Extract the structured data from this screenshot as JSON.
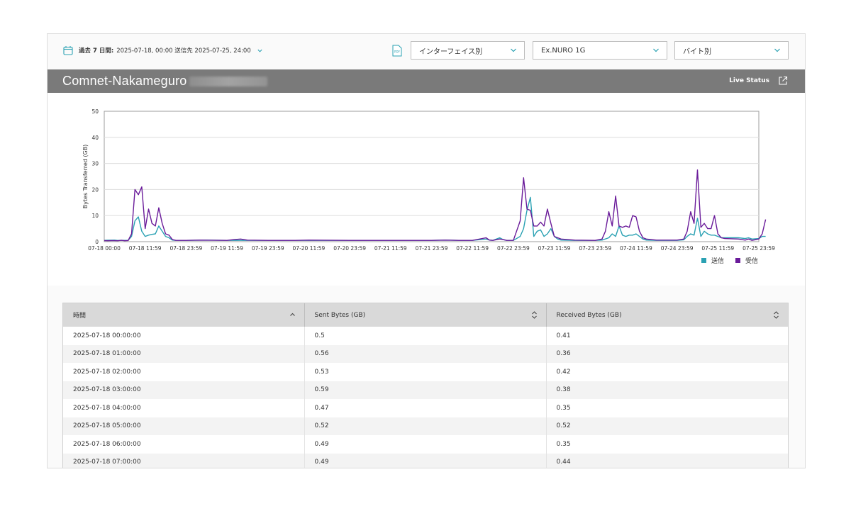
{
  "toolbar": {
    "date_range_bold": "過去 7 日間:",
    "date_range_text": "2025-07-18, 00:00 送信先 2025-07-25, 24:00",
    "pdf_label": "PDF",
    "filter_interface": "インターフェイス別",
    "filter_uplink": "Ex.NURO 1G",
    "filter_unit": "バイト別"
  },
  "header": {
    "device_name": "Comnet-Nakameguro",
    "live_status": "Live Status"
  },
  "colors": {
    "sent": "#2aa1b3",
    "received": "#6a1b9a",
    "title_bar": "#7a7a7a"
  },
  "chart_data": {
    "type": "line",
    "ylabel": "Bytes Transferred (GB)",
    "xlabel": "",
    "ylim": [
      0,
      50
    ],
    "yticks": [
      "0",
      "10",
      "20",
      "30",
      "40",
      "50"
    ],
    "xticks": [
      "07-18 00:00",
      "07-18 11:59",
      "07-18 23:59",
      "07-19 11:59",
      "07-19 23:59",
      "07-20 11:59",
      "07-20 23:59",
      "07-21 11:59",
      "07-21 23:59",
      "07-22 11:59",
      "07-22 23:59",
      "07-23 11:59",
      "07-23 23:59",
      "07-24 11:59",
      "07-24 23:59",
      "07-25 11:59",
      "07-25 23:59"
    ],
    "x_unit": "hours since 07-18 00:00",
    "grid": true,
    "legend_position": "bottom-right",
    "series": [
      {
        "name": "送信",
        "color": "#2aa1b3",
        "points": [
          [
            0,
            0.5
          ],
          [
            1,
            0.56
          ],
          [
            2,
            0.53
          ],
          [
            3,
            0.59
          ],
          [
            4,
            0.47
          ],
          [
            5,
            0.52
          ],
          [
            6,
            0.49
          ],
          [
            7,
            0.49
          ],
          [
            8,
            2
          ],
          [
            9,
            8
          ],
          [
            10,
            9.5
          ],
          [
            11,
            4
          ],
          [
            12,
            2
          ],
          [
            13,
            2.5
          ],
          [
            14,
            2.8
          ],
          [
            15,
            3
          ],
          [
            16,
            6
          ],
          [
            17,
            4
          ],
          [
            18,
            2
          ],
          [
            19,
            1.5
          ],
          [
            20,
            0.6
          ],
          [
            21,
            0.5
          ],
          [
            24,
            0.5
          ],
          [
            30,
            0.6
          ],
          [
            36,
            0.5
          ],
          [
            40,
            0.5
          ],
          [
            48,
            0.5
          ],
          [
            56,
            0.5
          ],
          [
            60,
            0.5
          ],
          [
            72,
            0.5
          ],
          [
            84,
            0.5
          ],
          [
            96,
            0.5
          ],
          [
            100,
            0.6
          ],
          [
            104,
            0.5
          ],
          [
            108,
            0.5
          ],
          [
            112,
            1
          ],
          [
            113,
            0.6
          ],
          [
            114,
            0.5
          ],
          [
            116,
            1.5
          ],
          [
            117,
            0.8
          ],
          [
            118,
            0.5
          ],
          [
            120,
            0.5
          ],
          [
            122,
            2
          ],
          [
            123,
            5
          ],
          [
            124,
            12
          ],
          [
            125,
            17
          ],
          [
            126,
            2
          ],
          [
            127,
            4
          ],
          [
            128,
            4.5
          ],
          [
            129,
            2
          ],
          [
            130,
            3
          ],
          [
            131,
            5
          ],
          [
            132,
            2
          ],
          [
            133,
            1
          ],
          [
            134,
            0.6
          ],
          [
            138,
            0.5
          ],
          [
            144,
            0.5
          ],
          [
            146,
            0.6
          ],
          [
            148,
            1.5
          ],
          [
            149,
            3
          ],
          [
            150,
            2
          ],
          [
            151,
            6
          ],
          [
            152,
            2.5
          ],
          [
            153,
            2
          ],
          [
            154,
            2.5
          ],
          [
            155,
            2.5
          ],
          [
            156,
            3
          ],
          [
            157,
            2
          ],
          [
            158,
            1
          ],
          [
            159,
            0.6
          ],
          [
            162,
            0.5
          ],
          [
            168,
            0.5
          ],
          [
            170,
            0.7
          ],
          [
            171,
            2
          ],
          [
            172,
            3
          ],
          [
            173,
            2.5
          ],
          [
            174,
            9
          ],
          [
            175,
            2
          ],
          [
            176,
            4
          ],
          [
            177,
            3
          ],
          [
            178,
            2.5
          ],
          [
            179,
            2.5
          ],
          [
            180,
            2
          ],
          [
            181,
            1.5
          ],
          [
            182,
            1.5
          ],
          [
            186,
            1.5
          ],
          [
            188,
            1.2
          ],
          [
            189,
            1.5
          ],
          [
            190,
            1
          ],
          [
            192,
            1.2
          ],
          [
            193,
            2
          ],
          [
            194,
            2
          ]
        ]
      },
      {
        "name": "受信",
        "color": "#6a1b9a",
        "points": [
          [
            0,
            0.41
          ],
          [
            1,
            0.36
          ],
          [
            2,
            0.42
          ],
          [
            3,
            0.38
          ],
          [
            4,
            0.35
          ],
          [
            5,
            0.52
          ],
          [
            6,
            0.35
          ],
          [
            7,
            0.44
          ],
          [
            8,
            3
          ],
          [
            9,
            20
          ],
          [
            10,
            18
          ],
          [
            11,
            21
          ],
          [
            12,
            5
          ],
          [
            13,
            12.5
          ],
          [
            14,
            7
          ],
          [
            15,
            6
          ],
          [
            16,
            13
          ],
          [
            17,
            7
          ],
          [
            18,
            3
          ],
          [
            19,
            2.5
          ],
          [
            20,
            0.8
          ],
          [
            21,
            0.5
          ],
          [
            24,
            0.5
          ],
          [
            28,
            0.6
          ],
          [
            36,
            0.5
          ],
          [
            38,
            0.8
          ],
          [
            40,
            1
          ],
          [
            42,
            0.6
          ],
          [
            48,
            0.5
          ],
          [
            56,
            0.5
          ],
          [
            60,
            0.6
          ],
          [
            72,
            0.5
          ],
          [
            84,
            0.5
          ],
          [
            96,
            0.5
          ],
          [
            100,
            0.6
          ],
          [
            104,
            0.5
          ],
          [
            108,
            0.5
          ],
          [
            112,
            1.5
          ],
          [
            113,
            0.6
          ],
          [
            114,
            0.5
          ],
          [
            116,
            1
          ],
          [
            117,
            0.8
          ],
          [
            118,
            0.5
          ],
          [
            120,
            0.5
          ],
          [
            122,
            8
          ],
          [
            123,
            24.5
          ],
          [
            124,
            12.5
          ],
          [
            125,
            12
          ],
          [
            126,
            6
          ],
          [
            127,
            6
          ],
          [
            128,
            7.5
          ],
          [
            129,
            6
          ],
          [
            130,
            12.5
          ],
          [
            131,
            7
          ],
          [
            132,
            2
          ],
          [
            133,
            1.5
          ],
          [
            134,
            1
          ],
          [
            138,
            0.6
          ],
          [
            144,
            0.5
          ],
          [
            146,
            1
          ],
          [
            147,
            4
          ],
          [
            148,
            11.5
          ],
          [
            149,
            6
          ],
          [
            150,
            17.5
          ],
          [
            151,
            6
          ],
          [
            152,
            5.5
          ],
          [
            153,
            6
          ],
          [
            154,
            5.5
          ],
          [
            155,
            10
          ],
          [
            156,
            9.5
          ],
          [
            157,
            4
          ],
          [
            158,
            1.5
          ],
          [
            159,
            1
          ],
          [
            162,
            0.6
          ],
          [
            168,
            0.6
          ],
          [
            170,
            1
          ],
          [
            171,
            4
          ],
          [
            172,
            11.5
          ],
          [
            173,
            7
          ],
          [
            174,
            27.5
          ],
          [
            175,
            5.5
          ],
          [
            176,
            7
          ],
          [
            177,
            5
          ],
          [
            178,
            5
          ],
          [
            179,
            10
          ],
          [
            180,
            3
          ],
          [
            181,
            1.5
          ],
          [
            182,
            1.2
          ],
          [
            186,
            1
          ],
          [
            188,
            0.6
          ],
          [
            189,
            1
          ],
          [
            190,
            0.5
          ],
          [
            192,
            1
          ],
          [
            193,
            3
          ],
          [
            194,
            8.5
          ]
        ]
      }
    ]
  },
  "table": {
    "headers": [
      "時間",
      "Sent Bytes (GB)",
      "Received Bytes (GB)"
    ],
    "rows": [
      [
        "2025-07-18 00:00:00",
        "0.5",
        "0.41"
      ],
      [
        "2025-07-18 01:00:00",
        "0.56",
        "0.36"
      ],
      [
        "2025-07-18 02:00:00",
        "0.53",
        "0.42"
      ],
      [
        "2025-07-18 03:00:00",
        "0.59",
        "0.38"
      ],
      [
        "2025-07-18 04:00:00",
        "0.47",
        "0.35"
      ],
      [
        "2025-07-18 05:00:00",
        "0.52",
        "0.52"
      ],
      [
        "2025-07-18 06:00:00",
        "0.49",
        "0.35"
      ],
      [
        "2025-07-18 07:00:00",
        "0.49",
        "0.44"
      ]
    ]
  }
}
